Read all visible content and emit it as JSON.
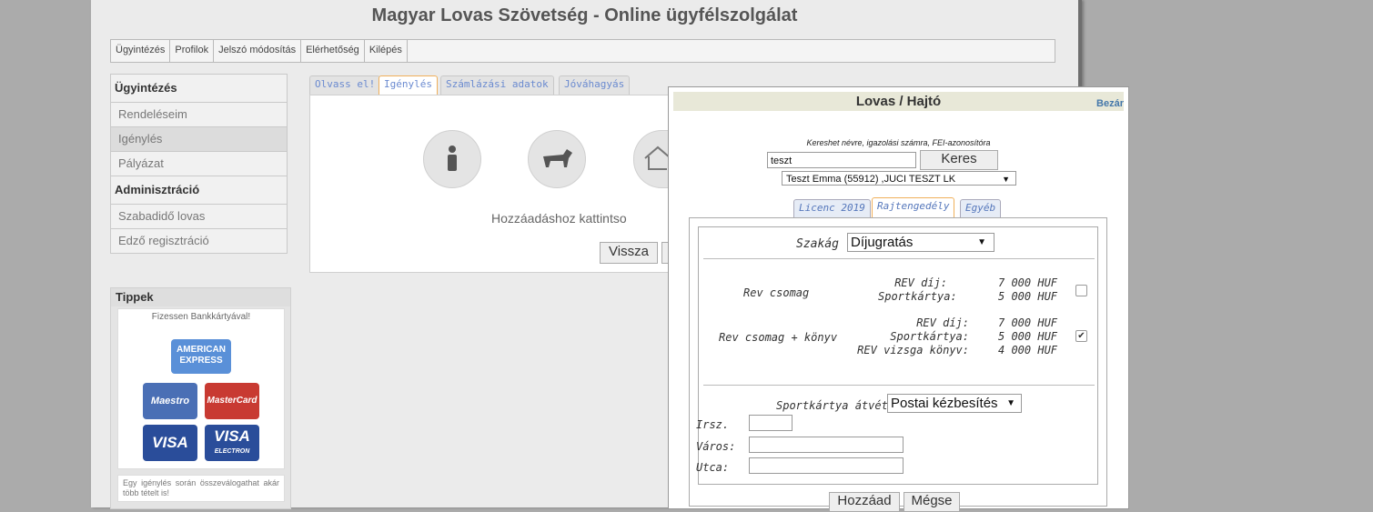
{
  "header": {
    "title": "Magyar Lovas Szövetség - Online ügyfélszolgálat"
  },
  "topnav": [
    "Ügyintézés",
    "Profilok",
    "Jelszó módosítás",
    "Elérhetőség",
    "Kilépés"
  ],
  "sidebar": {
    "section1": "Ügyintézés",
    "items1": [
      "Rendeléseim",
      "Igénylés",
      "Pályázat"
    ],
    "section2": "Adminisztráció",
    "items2": [
      "Szabadidő lovas",
      "Edző regisztráció"
    ],
    "active": "Igénylés"
  },
  "tips": {
    "title": "Tippek",
    "card_text": "Fizessen Bankkártyával!",
    "brands": [
      "AMERICAN EXPRESS",
      "Maestro",
      "MasterCard",
      "VISA",
      "VISA",
      "ELECTRON"
    ],
    "note": "Egy igénylés során összeválogathat akár több tételt is!"
  },
  "tabs": [
    "Olvass el!",
    "Igénylés",
    "Számlázási adatok",
    "Jóváhagyás"
  ],
  "main": {
    "hint": "Hozzáadáshoz kattintso",
    "back_button": "Vissza"
  },
  "modal": {
    "title": "Lovas / Hajtó",
    "close": "Bezár",
    "search_hint": "Kereshet névre, igazolási számra, FEI-azonosítóra",
    "search_value": "teszt",
    "search_button": "Keres",
    "result_select": "Teszt Emma (55912) ,JUCI TESZT LK",
    "tabs": [
      "Licenc 2019",
      "Rajtengedély",
      "Egyéb"
    ],
    "discipline_label": "Szakág",
    "discipline_value": "Díjugratás",
    "packages": [
      {
        "name": "Rev csomag",
        "lines": [
          [
            "REV díj:",
            "7 000 HUF"
          ],
          [
            "Sportkártya:",
            "5 000 HUF"
          ]
        ],
        "checked": false
      },
      {
        "name": "Rev csomag + könyv",
        "lines": [
          [
            "REV díj:",
            "7 000 HUF"
          ],
          [
            "Sportkártya:",
            "5 000 HUF"
          ],
          [
            "REV vizsga könyv:",
            "4 000 HUF"
          ]
        ],
        "checked": true
      }
    ],
    "delivery_label": "Sportkártya átvétel",
    "delivery_value": "Postai kézbesítés",
    "zip_label": "Irsz.",
    "city_label": "Város:",
    "street_label": "Utca:",
    "add_button": "Hozzáad",
    "cancel_button": "Mégse"
  }
}
